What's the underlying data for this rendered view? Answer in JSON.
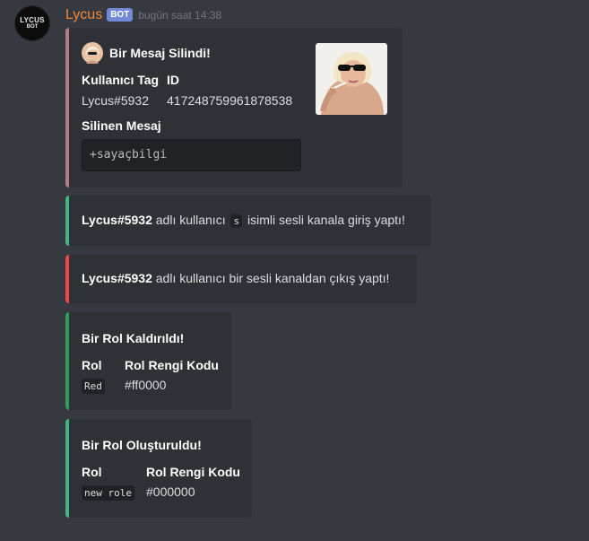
{
  "message": {
    "username": "Lycus",
    "bot_tag": "BOT",
    "timestamp": "bugün saat 14:38",
    "avatar_text_1": "LYCUS",
    "avatar_text_2": "BOT"
  },
  "embeds": {
    "deleted": {
      "color": "#b6788b",
      "title": "Bir Mesaj Silindi!",
      "field1_name": "Kullanıcı Tag",
      "field1_value": "Lycus#5932",
      "field2_name": "ID",
      "field2_value": "417248759961878538",
      "field3_name": "Silinen Mesaj",
      "field3_value": "+sayaçbilgi"
    },
    "join": {
      "color": "#43b581",
      "user": "Lycus#5932",
      "text1": "adlı kullanıcı",
      "channel": "s",
      "text2": "isimli sesli kanala giriş yaptı!"
    },
    "leave": {
      "color": "#f04747",
      "user": "Lycus#5932",
      "text": "adlı kullanıcı bir sesli kanaldan çıkış yaptı!"
    },
    "role_removed": {
      "color": "#2e9d5a",
      "title": "Bir Rol Kaldırıldı!",
      "field1_name": "Rol",
      "field1_value": "Red",
      "field2_name": "Rol Rengi Kodu",
      "field2_value": "#ff0000"
    },
    "role_created": {
      "color": "#43b581",
      "title": "Bir Rol Oluşturuldu!",
      "field1_name": "Rol",
      "field1_value": "new role",
      "field2_name": "Rol Rengi Kodu",
      "field2_value": "#000000"
    }
  }
}
